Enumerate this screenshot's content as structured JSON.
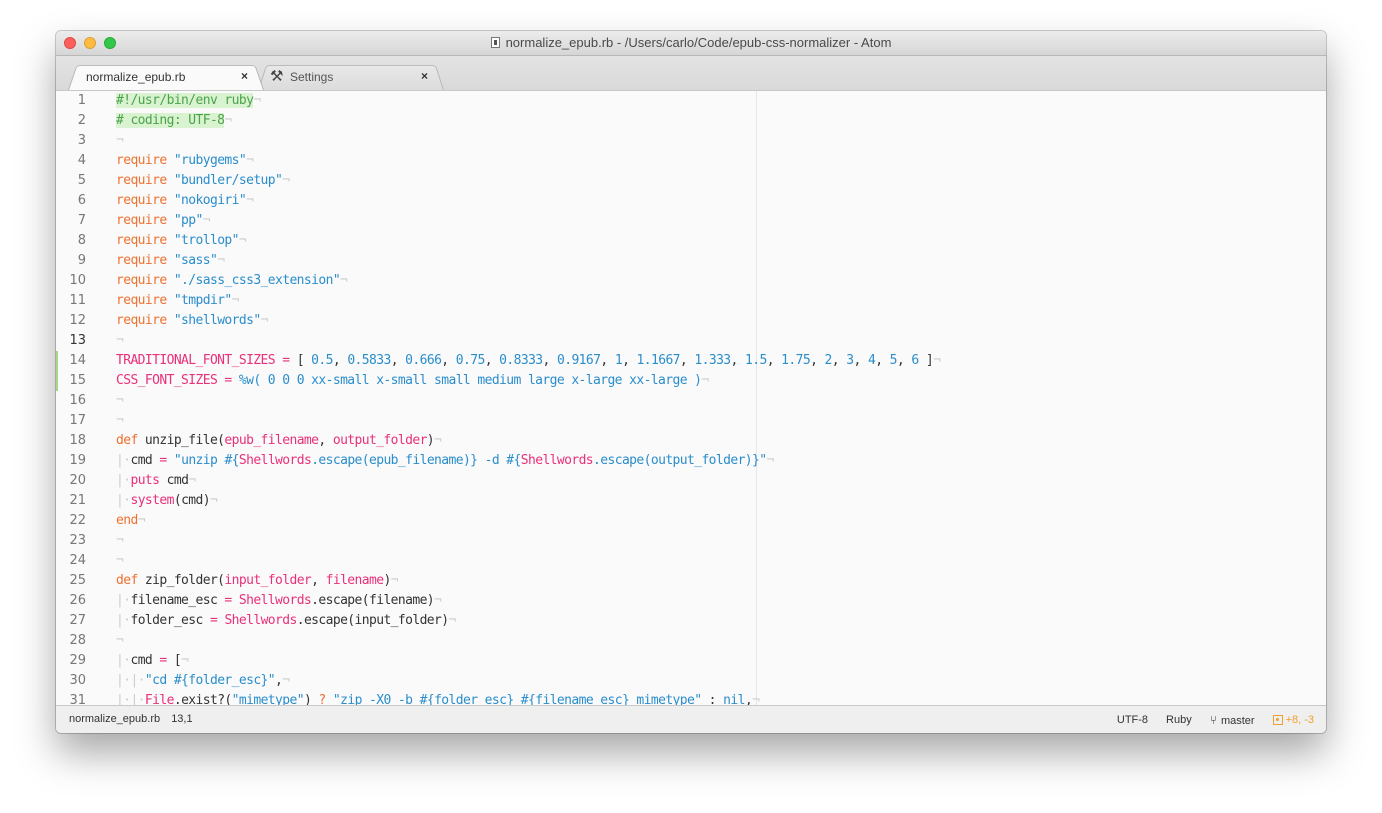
{
  "window": {
    "title": "normalize_epub.rb - /Users/carlo/Code/epub-css-normalizer - Atom"
  },
  "tabs": [
    {
      "label": "normalize_epub.rb",
      "close": "×",
      "active": true
    },
    {
      "label": "Settings",
      "close": "×",
      "active": false,
      "icon": "tools-icon"
    }
  ],
  "editor": {
    "current_line": 13,
    "modified_lines": [
      14,
      15
    ],
    "lines": [
      {
        "n": "1",
        "html": "<span class='c-cmt'>#!/usr/bin/env ruby</span><span class='c-inv'>¬</span>"
      },
      {
        "n": "2",
        "html": "<span class='c-cmt'># coding: UTF-8</span><span class='c-inv'>¬</span>"
      },
      {
        "n": "3",
        "html": "<span class='c-inv'>¬</span>"
      },
      {
        "n": "4",
        "html": "<span class='c-kw'>require</span> <span class='c-str'>\"rubygems\"</span><span class='c-inv'>¬</span>"
      },
      {
        "n": "5",
        "html": "<span class='c-kw'>require</span> <span class='c-str'>\"bundler/setup\"</span><span class='c-inv'>¬</span>"
      },
      {
        "n": "6",
        "html": "<span class='c-kw'>require</span> <span class='c-str'>\"nokogiri\"</span><span class='c-inv'>¬</span>"
      },
      {
        "n": "7",
        "html": "<span class='c-kw'>require</span> <span class='c-str'>\"pp\"</span><span class='c-inv'>¬</span>"
      },
      {
        "n": "8",
        "html": "<span class='c-kw'>require</span> <span class='c-str'>\"trollop\"</span><span class='c-inv'>¬</span>"
      },
      {
        "n": "9",
        "html": "<span class='c-kw'>require</span> <span class='c-str'>\"sass\"</span><span class='c-inv'>¬</span>"
      },
      {
        "n": "10",
        "html": "<span class='c-kw'>require</span> <span class='c-str'>\"./sass_css3_extension\"</span><span class='c-inv'>¬</span>"
      },
      {
        "n": "11",
        "html": "<span class='c-kw'>require</span> <span class='c-str'>\"tmpdir\"</span><span class='c-inv'>¬</span>"
      },
      {
        "n": "12",
        "html": "<span class='c-kw'>require</span> <span class='c-str'>\"shellwords\"</span><span class='c-inv'>¬</span>"
      },
      {
        "n": "13",
        "html": "<span class='c-inv'>¬</span>"
      },
      {
        "n": "14",
        "html": "<span class='c-const'>TRADITIONAL_FONT_SIZES</span> <span class='c-op'>=</span> [ <span class='c-num'>0.5</span>, <span class='c-num'>0.5833</span>, <span class='c-num'>0.666</span>, <span class='c-num'>0.75</span>, <span class='c-num'>0.8333</span>, <span class='c-num'>0.9167</span>, <span class='c-num'>1</span>, <span class='c-num'>1.1667</span>, <span class='c-num'>1.333</span>, <span class='c-num'>1.5</span>, <span class='c-num'>1.75</span>, <span class='c-num'>2</span>, <span class='c-num'>3</span>, <span class='c-num'>4</span>, <span class='c-num'>5</span>, <span class='c-num'>6</span> ]<span class='c-inv'>¬</span>"
      },
      {
        "n": "15",
        "html": "<span class='c-const'>CSS_FONT_SIZES</span> <span class='c-op'>=</span> <span class='c-str'>%w( 0 0 0 xx-small x-small small medium large x-large xx-large )</span><span class='c-inv'>¬</span>"
      },
      {
        "n": "16",
        "html": "<span class='c-inv'>¬</span>"
      },
      {
        "n": "17",
        "html": "<span class='c-inv'>¬</span>"
      },
      {
        "n": "18",
        "html": "<span class='c-kw'>def</span> unzip_file(<span class='c-param'>epub_filename</span>, <span class='c-param'>output_folder</span>)<span class='c-inv'>¬</span>"
      },
      {
        "n": "19",
        "html": "<span class='c-indent'>|·</span>cmd <span class='c-op'>=</span> <span class='c-str'>\"unzip #{<span class='c-const'>Shellwords</span>.escape(epub_filename)} -d #{<span class='c-const'>Shellwords</span>.escape(output_folder)}\"</span><span class='c-inv'>¬</span>"
      },
      {
        "n": "20",
        "html": "<span class='c-indent'>|·</span><span class='c-fn'>puts</span> cmd<span class='c-inv'>¬</span>"
      },
      {
        "n": "21",
        "html": "<span class='c-indent'>|·</span><span class='c-fn'>system</span>(cmd)<span class='c-inv'>¬</span>"
      },
      {
        "n": "22",
        "html": "<span class='c-kw'>end</span><span class='c-inv'>¬</span>"
      },
      {
        "n": "23",
        "html": "<span class='c-inv'>¬</span>"
      },
      {
        "n": "24",
        "html": "<span class='c-inv'>¬</span>"
      },
      {
        "n": "25",
        "html": "<span class='c-kw'>def</span> zip_folder(<span class='c-param'>input_folder</span>, <span class='c-param'>filename</span>)<span class='c-inv'>¬</span>"
      },
      {
        "n": "26",
        "html": "<span class='c-indent'>|·</span>filename_esc <span class='c-op'>=</span> <span class='c-const'>Shellwords</span>.escape(filename)<span class='c-inv'>¬</span>"
      },
      {
        "n": "27",
        "html": "<span class='c-indent'>|·</span>folder_esc <span class='c-op'>=</span> <span class='c-const'>Shellwords</span>.escape(input_folder)<span class='c-inv'>¬</span>"
      },
      {
        "n": "28",
        "html": "<span class='c-inv'>¬</span>"
      },
      {
        "n": "29",
        "html": "<span class='c-indent'>|·</span>cmd <span class='c-op'>=</span> [<span class='c-inv'>¬</span>"
      },
      {
        "n": "30",
        "html": "<span class='c-indent'>|·|·</span><span class='c-str'>\"cd #{folder_esc}\"</span>,<span class='c-inv'>¬</span>"
      },
      {
        "n": "31",
        "html": "<span class='c-indent'>|·|·</span><span class='c-const'>File</span>.exist?(<span class='c-str'>\"mimetype\"</span>) <span class='c-kw'>?</span> <span class='c-str'>\"zip -X0 -b #{folder_esc} #{filename_esc} mimetype\"</span> : <span class='c-str'>nil</span>,<span class='c-inv'>¬</span>"
      }
    ]
  },
  "statusbar": {
    "file": "normalize_epub.rb",
    "cursor": "13,1",
    "encoding": "UTF-8",
    "grammar": "Ruby",
    "branch": "master",
    "diff": "+8, -3"
  },
  "colors": {
    "keyword": "#f07030",
    "string": "#2a8dcc",
    "constant": "#e8307b",
    "comment": "#4aa44a",
    "git_modified": "#f0a030",
    "git_added_gutter": "#a6d785"
  }
}
